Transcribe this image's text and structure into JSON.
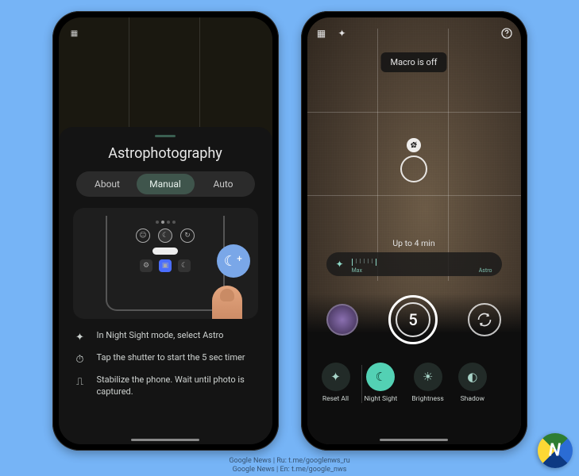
{
  "left": {
    "panel_title": "Astrophotography",
    "tabs": {
      "about": "About",
      "manual": "Manual",
      "auto": "Auto"
    },
    "tips": [
      {
        "icon": "sparkle-icon",
        "text": "In Night Sight mode, select Astro"
      },
      {
        "icon": "timer-icon",
        "text": "Tap the shutter to start the 5 sec timer"
      },
      {
        "icon": "tripod-icon",
        "text": "Stabilize the phone. Wait until photo is captured."
      }
    ]
  },
  "right": {
    "toast": "Macro is off",
    "exposure_label": "Up to 4 min",
    "slider": {
      "labels": [
        "Max",
        "Astro"
      ]
    },
    "shutter_count": "5",
    "controls": [
      {
        "label": "Reset All",
        "icon": "sparkle-reset-icon",
        "active": false
      },
      {
        "label": "Night Sight",
        "icon": "moon-icon",
        "active": true
      },
      {
        "label": "Brightness",
        "icon": "brightness-icon",
        "active": false
      },
      {
        "label": "Shadow",
        "icon": "contrast-icon",
        "active": false
      }
    ]
  },
  "credits": {
    "line1": "Google News | Ru: t.me/googlenws_ru",
    "line2": "Google News | En: t.me/google_nws"
  },
  "colors": {
    "accent": "#53d1b4",
    "fab": "#7aa7e8"
  }
}
